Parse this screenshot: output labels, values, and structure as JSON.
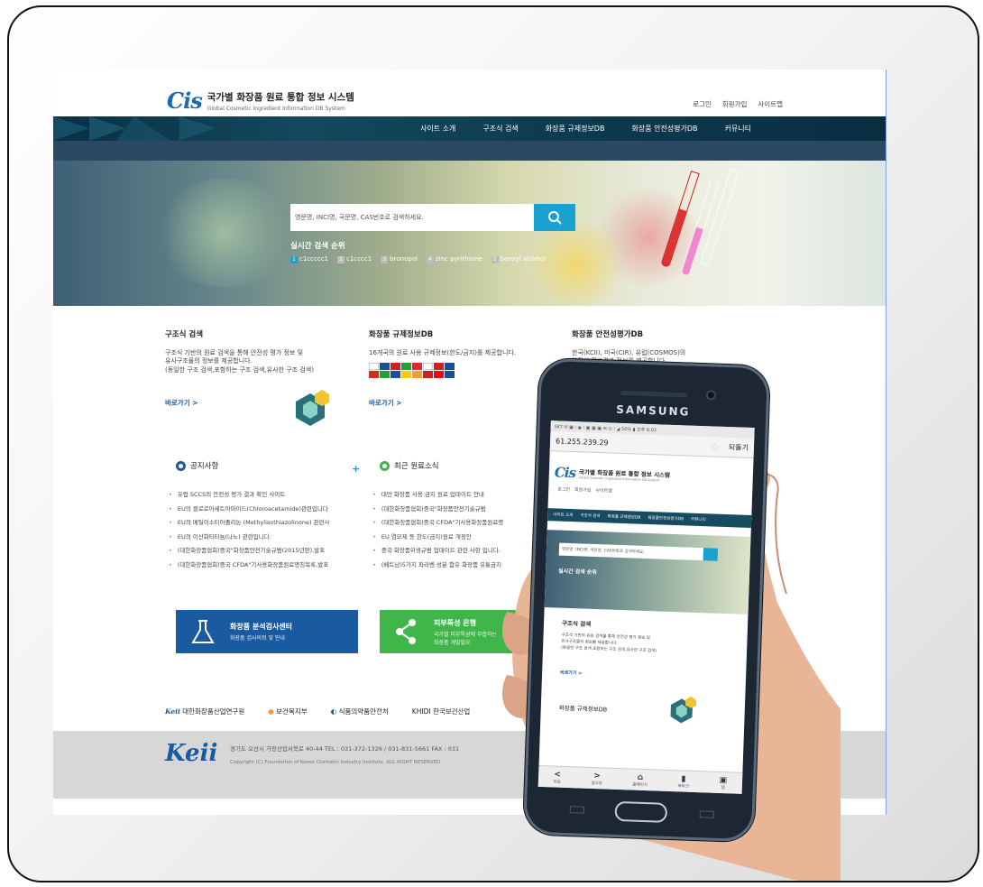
{
  "site": {
    "logo_mark": "Cis",
    "logo_title": "국가별 화장품 원료 통합 정보 시스템",
    "logo_subtitle": "Global Cosmetic Ingredient Information DB System",
    "top_links": [
      "로그인",
      "회원가입",
      "사이트맵"
    ],
    "nav": [
      "사이트 소개",
      "구조식 검색",
      "화장품 규제정보DB",
      "화장품 안전성평가DB",
      "커뮤니티"
    ],
    "search_placeholder": "영문명, INCI명, 국문명, CAS번호로 검색하세요.",
    "realtime_title": "실시간 검색 순위",
    "realtime": [
      {
        "rank": "1",
        "term": "c1ccccc1"
      },
      {
        "rank": "2",
        "term": "c1cccc1"
      },
      {
        "rank": "3",
        "term": "bronopol"
      },
      {
        "rank": "4",
        "term": "zinc pyrithione"
      },
      {
        "rank": "5",
        "term": "benzyl alcohol"
      }
    ],
    "columns": [
      {
        "title": "구조식 검색",
        "desc1": "구조식 기반의 원료 검색을 통해 안전성 평가 정보 및",
        "desc2": "유사구조물의 정보를 제공합니다.",
        "desc3": "(동일한 구조 검색,포함하는 구조 검색,유사한 구조 검색)",
        "goto": "바로가기 >"
      },
      {
        "title": "화장품 규제정보DB",
        "desc1": "16개국의 원료 사용 규제정보(한도/금지)를 제공합니다.",
        "goto": "바로가기 >"
      },
      {
        "title": "화장품 안전성평가DB",
        "desc1": "한국(KCII), 미국(CIR), 유럽(COSMOS)의",
        "desc2": "안전성 평가결과 정보를 제공합니다."
      }
    ],
    "notice_title": "공지사항",
    "notice_plus": "+",
    "notices": [
      "유럽 SCCS의 안전성 평가 결과 확인 사이트",
      "EU의 클로로아세트아마이드(Chloroacetamide)관련입니다",
      "EU의 메틸이소티아졸리논 (Methylisothiazolinone) 관련사",
      "EU의 이산화티타늄(나노) 관련입니다.",
      "(대한화장품협회)중국\"화장품안전기술규범(2015년판),발표",
      "(대한화장품협회)중국 CFDA\"기사용화장품원료명칭목록,발표"
    ],
    "news_title": "최근 원료소식",
    "news": [
      "대만 화장품 사용 금지 원료 업데이트 안내",
      "(대한화장품협회)중국\"화장품안전기술규범",
      "(대한화장품협회)중국 CFDA\"기사용화장품원료명",
      "EU 염모제 등 한도(금지)원료 개정안",
      "중국 화장품위생규범 업데이트 관련 사항 입니다.",
      "(베트남)5가지 파라벤 성분 함유 화장품 유통금지"
    ],
    "banner1_title": "화장품 분석검사센터",
    "banner1_sub": "화장품 검사의뢰 및 안내",
    "banner2_title": "피부특성 은행",
    "banner2_sub1": "국가별 피부특성에 부합하는",
    "banner2_sub2": "화장품 개발필요",
    "partners": [
      "대한화장품산업연구원",
      "보건복지부",
      "식품의약품안전처",
      "KHIDI 한국보건산업"
    ],
    "keii_sub": "Foundation of Korea Cosmetic Industry Institute",
    "footer_addr": "경기도 오산시 가장산업서북로 40-44   TEL : 031-372-1326 / 031-831-5661   FAX : 031",
    "footer_copy": "Copyright (C) Foundation of Korea Cosmetic Industry Institute. ALL RIGHT RESERVED."
  },
  "phone": {
    "brand": "SAMSUNG",
    "status": "SKT ✉ ▣  ⁝ ◉ ⁝ ▣ ▣ ▣   ✉ ◷ ⁝ ◢ 50% ▮ 오후 6:02",
    "url": "61.255.239.29",
    "url_action": "되돌기",
    "m_links": [
      "로그인",
      "회원가입",
      "사이트맵"
    ],
    "m_nav": [
      "사이트 소개",
      "구조식 검색",
      "화장품 규제정보DB",
      "화장품안전성평가DB",
      "커뮤니티"
    ],
    "m_search": "영문명, INCI명, 국문명, CAS번호로 검색하세요.",
    "m_rt": "실시간 검색 순위",
    "m_card_title": "구조식 검색",
    "m_card_l1": "구조식 기반의 원료 검색을 통해 안전성 평가 정보 및",
    "m_card_l2": "유사구조물의 정보를 제공합니다.",
    "m_card_l3": "(동일한 구조 검색,포함하는 구조 검색,유사한 구조 검색)",
    "m_goto": "바로가기 >",
    "m_sec": "화장품 규제정보DB",
    "bottom": [
      {
        "icon": "<",
        "label": "뒤로"
      },
      {
        "icon": ">",
        "label": "앞으로"
      },
      {
        "icon": "⌂",
        "label": "홈페이지"
      },
      {
        "icon": "▮",
        "label": "북마크"
      },
      {
        "icon": "▣",
        "label": "탭"
      }
    ]
  },
  "colors": {
    "accent": "#1aa1d0",
    "brand_blue": "#1a5aa0",
    "green": "#3fb54a",
    "nav": "#0d3b4f"
  }
}
